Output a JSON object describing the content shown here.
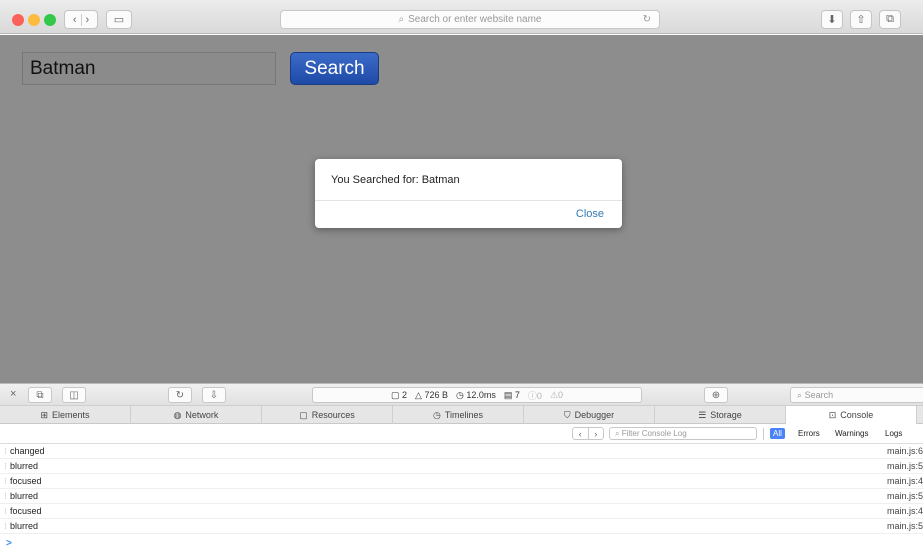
{
  "browser": {
    "url_placeholder": "Search or enter website name",
    "traffic_lights": [
      "#fc605b",
      "#fdbc40",
      "#34c84a"
    ]
  },
  "page": {
    "search_value": "Batman",
    "search_button_label": "Search",
    "modal": {
      "message": "You Searched for: Batman",
      "close_label": "Close"
    }
  },
  "devtools": {
    "stats": {
      "resources": "2",
      "size": "726 B",
      "time": "12.0ms",
      "logs": "7",
      "errors": "0",
      "warnings": "0"
    },
    "search_placeholder": "Search",
    "tabs": [
      {
        "label": "Elements",
        "icon": "elements-icon"
      },
      {
        "label": "Network",
        "icon": "network-icon"
      },
      {
        "label": "Resources",
        "icon": "resources-icon"
      },
      {
        "label": "Timelines",
        "icon": "timelines-icon"
      },
      {
        "label": "Debugger",
        "icon": "debugger-icon"
      },
      {
        "label": "Storage",
        "icon": "storage-icon"
      },
      {
        "label": "Console",
        "icon": "console-icon",
        "active": true
      }
    ],
    "filter_placeholder": "Filter Console Log",
    "filters": [
      "All",
      "Errors",
      "Warnings",
      "Logs"
    ],
    "console_lines": [
      {
        "message": "changed",
        "source": "main.js:6"
      },
      {
        "message": "blurred",
        "source": "main.js:5"
      },
      {
        "message": "focused",
        "source": "main.js:4"
      },
      {
        "message": "blurred",
        "source": "main.js:5"
      },
      {
        "message": "focused",
        "source": "main.js:4"
      },
      {
        "message": "blurred",
        "source": "main.js:5"
      }
    ],
    "prompt": ">"
  }
}
